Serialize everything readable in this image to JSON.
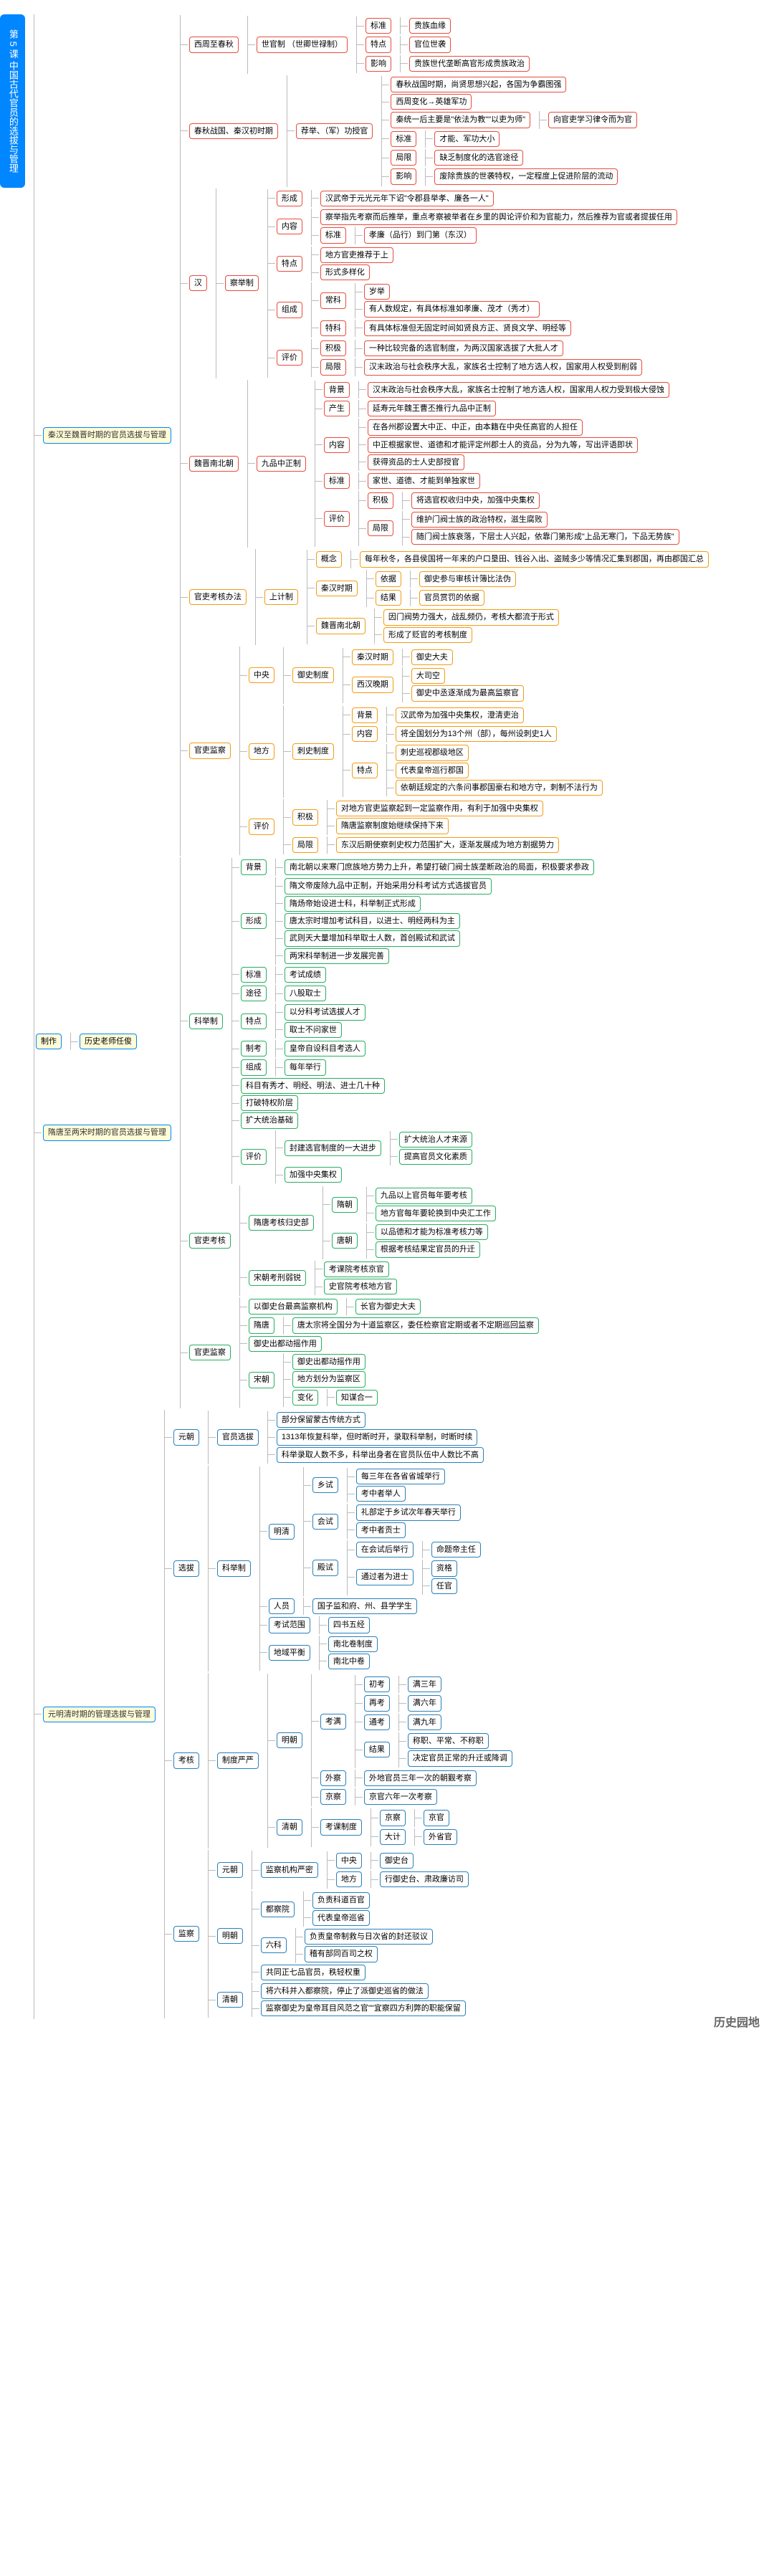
{
  "root": "第 5 课 中国古代官员的选拔与管理",
  "author_label": "制作",
  "author_value": "历史老师任俊",
  "footer": "历史园地",
  "sec1": {
    "title": "秦汉至魏晋时期的官员选拔与管理",
    "n1": {
      "t": "西周至春秋",
      "c": "世官制\n（世卿世禄制）",
      "i1": "标准",
      "i1v": "贵族血缘",
      "i2": "特点",
      "i2v": "官位世袭",
      "i3": "影响",
      "i3v": "贵族世代垄断高官形成贵族政治"
    },
    "n2": {
      "t": "春秋战国、秦汉初时期",
      "c": "荐举、（军）功授官",
      "a": "春秋战国时期，尚贤思想兴起，各国为争霸图强",
      "b": "西周变化→英雄军功",
      "c2": "秦统一后主要是\"依法为教\"\"以吏为师\"",
      "c2b": "向官吏学习律令而为官",
      "d": "标准",
      "dv": "才能、军功大小",
      "e": "局限",
      "ev": "缺乏制度化的选官途径",
      "f": "影响",
      "fv": "废除贵族的世袭特权，一定程度上促进阶层的流动"
    },
    "n3": {
      "t": "汉",
      "c": "察举制",
      "a": "形成",
      "av": "汉武帝于元光元年下诏\"令郡县举孝、廉各一人\"",
      "b": "内容",
      "bv1": "察举指先考察而后推举，重点考察被举者在乡里的舆论评价和为官能力，然后推荐为官或者提拔任用",
      "bv2": "标准",
      "bv2v": "孝廉（品行）到门第（东汉）",
      "c3": "特点",
      "cv1": "地方官吏推荐于上",
      "cv2": "形式多样化",
      "d": "组成",
      "d1": "常科",
      "d1a": "岁举",
      "d1b": "有人数规定，有具体标准如孝廉、茂才（秀才）",
      "d2": "特科",
      "d2a": "有具体标准但无固定时间如贤良方正、贤良文学、明经等",
      "e": "评价",
      "e1": "积极",
      "e1v": "一种比较完备的选官制度，为两汉国家选拔了大批人才",
      "e2": "局限",
      "e2v": "汉末政治与社会秩序大乱，家族名士控制了地方选人权，国家用人权受到削弱"
    },
    "n4": {
      "t": "魏晋南北朝",
      "c": "九品中正制",
      "a": "背景",
      "av": "汉末政治与社会秩序大乱，家族名士控制了地方选人权，国家用人权力受到极大侵蚀",
      "b": "产生",
      "bv": "延寿元年魏王曹丕推行九品中正制",
      "c4": "内容",
      "cv1": "在各州郡设置大中正、中正，由本籍在中央任高官的人担任",
      "cv2": "中正根据家世、道德和才能评定州郡士人的资品，分为九等，写出评语即状",
      "cv3": "获得资品的士人史部授官",
      "d": "标准",
      "dv": "家世、道德、才能到单独家世",
      "e": "评价",
      "e1": "积极",
      "e1v": "将选官权收归中央，加强中央集权",
      "e2": "局限",
      "e2v1": "维护门阀士族的政治特权，滋生腐败",
      "e2v2": "随门阀士族衰落，下层士人兴起，依靠门第形成\"上品无寒门，下品无势族\""
    },
    "n5": {
      "t": "官吏考核办法",
      "c": "上计制",
      "a": "概念",
      "av": "每年秋冬，各县侯国将一年来的户口垦田、钱谷入出、盗贼多少等情况汇集到郡国，再由郡国汇总",
      "b": "秦汉时期",
      "b1": "依据",
      "b1v": "御史参与审核计簿比法伪",
      "b2": "结果",
      "b2v": "官员赏罚的依据",
      "c5": "魏晋南北朝",
      "cv": "因门阀势力强大，战乱频仍，考核大都流于形式",
      "d": "形成了贬官的考核制度"
    },
    "n6": {
      "t": "官吏监察",
      "a": "中央",
      "a1": "御史制度",
      "a1v1": "秦汉时期",
      "a1v1b": "御史大夫",
      "a1v2": "西汉晚期",
      "a1v2b": "大司空",
      "a1v2c": "御史中丞逐渐成为最高监察官",
      "b": "地方",
      "b1": "刺史制度",
      "b1a": "背景",
      "b1av": "汉武帝为加强中央集权，澄清吏治",
      "b1b": "内容",
      "b1bv": "将全国划分为13个州（部），每州设刺史1人",
      "b1c": "特点",
      "b1cv1": "刺史巡视郡级地区",
      "b1cv2": "代表皇帝巡行郡国",
      "b1cv3": "依朝廷规定的六条问事郡国豪右和地方守，刺制不法行为",
      "c6": "评价",
      "c1": "积极",
      "c1v": "对地方官吏监察起到一定监察作用，有利于加强中央集权",
      "c1v2": "隋唐监察制度始继续保持下来",
      "c2": "局限",
      "c2v": "东汉后期使察刺史权力范围扩大，逐渐发展成为地方割据势力"
    }
  },
  "sec2": {
    "title": "隋唐至两宋时期的官员选拔与管理",
    "n1": {
      "t": "科举制",
      "a": "背景",
      "av": "南北朝以来寒门庶族地方势力上升，希望打破门阀士族垄断政治的局面，积极要求参政",
      "b": "形成",
      "bv1": "隋文帝废除九品中正制，开始采用分科考试方式选拔官员",
      "bv2": "隋炀帝始设进士科，科举制正式形成",
      "bv3": "唐太宗时增加考试科目，以进士、明经两科为主",
      "bv4": "武则天大量增加科举取士人数，首创殿试和武试",
      "bv5": "两宋科举制进一步发展完善",
      "c7": "标准",
      "cv": "考试成绩",
      "cn": "途径",
      "cnv": "八股取士",
      "d": "特点",
      "dv1": "以分科考试选拔人才",
      "dv2": "取士不问家世",
      "e": "制考",
      "ev": "皇帝自设科目考选人",
      "f": "组成",
      "fv": "每年举行",
      "g": "科目有秀才、明经、明法、进士几十种",
      "h": "打破特权阶层",
      "i": "扩大统治基础",
      "j": "评价",
      "j1": "封建选官制度的一大进步",
      "j1a": "扩大统治人才来源",
      "j1b": "提高官员文化素质",
      "j2": "加强中央集权"
    },
    "n2": {
      "t": "官吏考核",
      "a": "隋唐考核归史部",
      "a1": "隋朝",
      "a1v1": "九品以上官员每年要考核",
      "a1v2": "地方官每年要轮换到中央汇工作",
      "a2": "唐朝",
      "a2v1": "以品德和才能为标准考核力等",
      "a2v2": "根据考核结果定官员的升迁",
      "b": "宋朝考刑弱锐",
      "bv": "考课院考核京官",
      "bv2": "史官院考核地方官"
    },
    "n3": {
      "t": "官吏监察",
      "a": "以御史台最高监察机构",
      "av": "长官为御史大夫",
      "b": "隋唐",
      "bv": "唐太宗将全国分为十道监察区，委任检察官定期或者不定期巡回监察",
      "c8": "御史出都动摇作用",
      "d": "宋朝",
      "d1": "御史出都动摇作用",
      "d2": "地方划分为监察区",
      "d3": "变化",
      "d3v": "知谋合一"
    }
  },
  "sec3": {
    "title": "元明清时期的管理选拔与管理",
    "n1": {
      "t": "官员选拔",
      "e": "元朝",
      "ev1": "部分保留蒙古传统方式",
      "ev2": "1313年恢复科举，但时断时开，录取科举制，时断时续",
      "ev3": "科举录取人数不多，科举出身者在官员队伍中人数比不高"
    },
    "n2": {
      "t": "选拔",
      "c": "科举制",
      "a": "明清",
      "a1": "乡试",
      "a1v1": "每三年在各省省城举行",
      "a1v2": "考中者举人",
      "a2": "会试",
      "a2v1": "礼部定于乡试次年春天举行",
      "a2v2": "考中者贡士",
      "a3": "殿试",
      "a3v1": "在会试后举行",
      "a3v2": "命题帝主任",
      "a3v3": "通过者为进士",
      "a3v4": "资格",
      "a3v5": "任官",
      "b": "人员",
      "bv": "国子监和府、州、县学学生",
      "c9": "考试范围",
      "cv": "四书五经",
      "d": "地域平衡",
      "dv1": "南北卷制度",
      "dv2": "南北中卷"
    },
    "n3": {
      "t": "考核",
      "c": "制度严严",
      "a": "明朝",
      "a1": "考满",
      "a1v1": "初考",
      "a1v1b": "满三年",
      "a1v2": "再考",
      "a1v2b": "满六年",
      "a1v3": "通考",
      "a1v3b": "满九年",
      "a1v4": "结果",
      "a1v4b": "称职、平常、不称职",
      "a1v5": "决定官员正常的升迁或降调",
      "a2": "外察",
      "a2v": "外地官员三年一次的朝觐考察",
      "a3": "京察",
      "a3v": "京官六年一次考察",
      "b": "清朝",
      "b1": "考课制度",
      "b1a": "京察",
      "b1av": "京官",
      "b1b": "大计",
      "b1bv": "外省官"
    },
    "n4": {
      "t": "监察",
      "a": "元朝",
      "av": "监察机构严密",
      "av1": "中央",
      "av1b": "御史台",
      "av2": "地方",
      "av2b": "行御史台、肃政廉访司",
      "b": "明朝",
      "b1": "都察院",
      "b1v1": "负责科道百官",
      "b1v2": "代表皇帝巡省",
      "b2": "六科",
      "b2v1": "负责皇帝制救与日次省的封还驳议",
      "b2v2": "稽有部同百司之权",
      "b3": "共同正七品官员，秩轻权重",
      "c10": "清朝",
      "cv1": "将六科并入都察院，停止了派御史巡省的做法",
      "cv2": "监察御史为皇帝耳目风范之官\"\"宜察四方利弊的职能保留"
    }
  }
}
